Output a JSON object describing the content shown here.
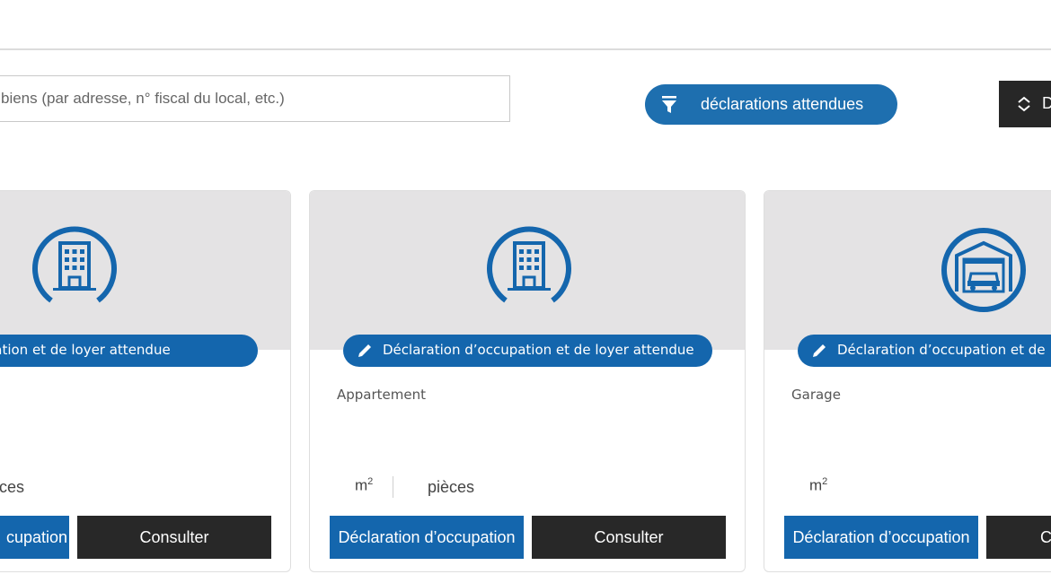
{
  "search": {
    "placeholder": "biens (par adresse, n° fiscal du local, etc.)"
  },
  "filter": {
    "label": "déclarations attendues",
    "icon": "funnel-icon"
  },
  "sort": {
    "label": "D",
    "icon": "sort-icon"
  },
  "colors": {
    "accent": "#1466ad",
    "dark": "#282828",
    "card_header_bg": "#e4e3e4"
  },
  "cards": [
    {
      "icon": "building-icon",
      "badge": "n d’occupation et de loyer attendue",
      "type": "",
      "area_unit": "",
      "rooms_label": "ces",
      "declare_label": "cupation",
      "consult_label": "Consulter"
    },
    {
      "icon": "building-icon",
      "badge": "Déclaration d’occupation et de loyer attendue",
      "type": "Appartement",
      "area_unit": "m",
      "area_exp": "2",
      "rooms_label": "pièces",
      "declare_label": "Déclaration d’occupation",
      "consult_label": "Consulter"
    },
    {
      "icon": "garage-icon",
      "badge": "Déclaration d’occupation et de",
      "type": "Garage",
      "area_unit": "m",
      "area_exp": "2",
      "rooms_label": "",
      "declare_label": "Déclaration d’occupation",
      "consult_label": "C"
    }
  ]
}
